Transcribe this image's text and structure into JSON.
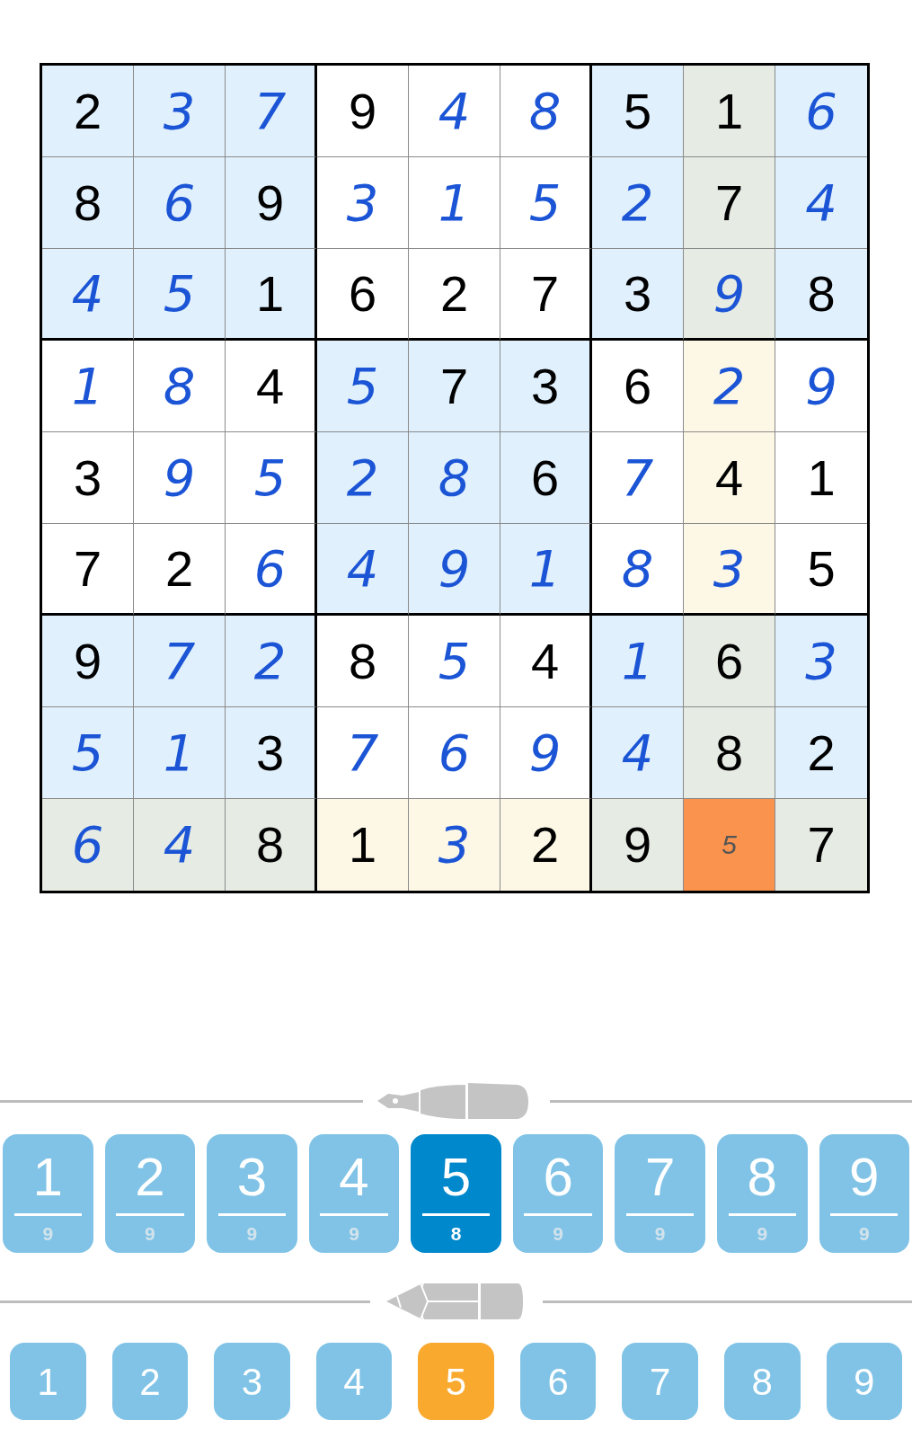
{
  "grid": [
    [
      {
        "v": "2",
        "kind": "given",
        "color": "#e0f0fc"
      },
      {
        "v": "3",
        "kind": "entered",
        "color": "#e0f0fc"
      },
      {
        "v": "7",
        "kind": "entered",
        "color": "#e0f0fc"
      },
      {
        "v": "9",
        "kind": "given",
        "color": "#ffffff"
      },
      {
        "v": "4",
        "kind": "entered",
        "color": "#ffffff"
      },
      {
        "v": "8",
        "kind": "entered",
        "color": "#ffffff"
      },
      {
        "v": "5",
        "kind": "given",
        "color": "#e0f0fc"
      },
      {
        "v": "1",
        "kind": "given",
        "color": "#e6ebe4"
      },
      {
        "v": "6",
        "kind": "entered",
        "color": "#e0f0fc"
      }
    ],
    [
      {
        "v": "8",
        "kind": "given",
        "color": "#e0f0fc"
      },
      {
        "v": "6",
        "kind": "entered",
        "color": "#e0f0fc"
      },
      {
        "v": "9",
        "kind": "given",
        "color": "#e0f0fc"
      },
      {
        "v": "3",
        "kind": "entered",
        "color": "#ffffff"
      },
      {
        "v": "1",
        "kind": "entered",
        "color": "#ffffff"
      },
      {
        "v": "5",
        "kind": "entered",
        "color": "#ffffff"
      },
      {
        "v": "2",
        "kind": "entered",
        "color": "#e0f0fc"
      },
      {
        "v": "7",
        "kind": "given",
        "color": "#e6ebe4"
      },
      {
        "v": "4",
        "kind": "entered",
        "color": "#e0f0fc"
      }
    ],
    [
      {
        "v": "4",
        "kind": "entered",
        "color": "#e0f0fc"
      },
      {
        "v": "5",
        "kind": "entered",
        "color": "#e0f0fc"
      },
      {
        "v": "1",
        "kind": "given",
        "color": "#e0f0fc"
      },
      {
        "v": "6",
        "kind": "given",
        "color": "#ffffff"
      },
      {
        "v": "2",
        "kind": "given",
        "color": "#ffffff"
      },
      {
        "v": "7",
        "kind": "given",
        "color": "#ffffff"
      },
      {
        "v": "3",
        "kind": "given",
        "color": "#e0f0fc"
      },
      {
        "v": "9",
        "kind": "entered",
        "color": "#e6ebe4"
      },
      {
        "v": "8",
        "kind": "given",
        "color": "#e0f0fc"
      }
    ],
    [
      {
        "v": "1",
        "kind": "entered",
        "color": "#ffffff"
      },
      {
        "v": "8",
        "kind": "entered",
        "color": "#ffffff"
      },
      {
        "v": "4",
        "kind": "given",
        "color": "#ffffff"
      },
      {
        "v": "5",
        "kind": "entered",
        "color": "#e0f0fc"
      },
      {
        "v": "7",
        "kind": "given",
        "color": "#e0f0fc"
      },
      {
        "v": "3",
        "kind": "given",
        "color": "#e0f0fc"
      },
      {
        "v": "6",
        "kind": "given",
        "color": "#ffffff"
      },
      {
        "v": "2",
        "kind": "entered",
        "color": "#fdf8e6"
      },
      {
        "v": "9",
        "kind": "entered",
        "color": "#ffffff"
      }
    ],
    [
      {
        "v": "3",
        "kind": "given",
        "color": "#ffffff"
      },
      {
        "v": "9",
        "kind": "entered",
        "color": "#ffffff"
      },
      {
        "v": "5",
        "kind": "entered",
        "color": "#ffffff"
      },
      {
        "v": "2",
        "kind": "entered",
        "color": "#e0f0fc"
      },
      {
        "v": "8",
        "kind": "entered",
        "color": "#e0f0fc"
      },
      {
        "v": "6",
        "kind": "given",
        "color": "#e0f0fc"
      },
      {
        "v": "7",
        "kind": "entered",
        "color": "#ffffff"
      },
      {
        "v": "4",
        "kind": "given",
        "color": "#fdf8e6"
      },
      {
        "v": "1",
        "kind": "given",
        "color": "#ffffff"
      }
    ],
    [
      {
        "v": "7",
        "kind": "given",
        "color": "#ffffff"
      },
      {
        "v": "2",
        "kind": "given",
        "color": "#ffffff"
      },
      {
        "v": "6",
        "kind": "entered",
        "color": "#ffffff"
      },
      {
        "v": "4",
        "kind": "entered",
        "color": "#e0f0fc"
      },
      {
        "v": "9",
        "kind": "entered",
        "color": "#e0f0fc"
      },
      {
        "v": "1",
        "kind": "entered",
        "color": "#e0f0fc"
      },
      {
        "v": "8",
        "kind": "entered",
        "color": "#ffffff"
      },
      {
        "v": "3",
        "kind": "entered",
        "color": "#fdf8e6"
      },
      {
        "v": "5",
        "kind": "given",
        "color": "#ffffff"
      }
    ],
    [
      {
        "v": "9",
        "kind": "given",
        "color": "#e0f0fc"
      },
      {
        "v": "7",
        "kind": "entered",
        "color": "#e0f0fc"
      },
      {
        "v": "2",
        "kind": "entered",
        "color": "#e0f0fc"
      },
      {
        "v": "8",
        "kind": "given",
        "color": "#ffffff"
      },
      {
        "v": "5",
        "kind": "entered",
        "color": "#ffffff"
      },
      {
        "v": "4",
        "kind": "given",
        "color": "#ffffff"
      },
      {
        "v": "1",
        "kind": "entered",
        "color": "#e0f0fc"
      },
      {
        "v": "6",
        "kind": "given",
        "color": "#e6ebe4"
      },
      {
        "v": "3",
        "kind": "entered",
        "color": "#e0f0fc"
      }
    ],
    [
      {
        "v": "5",
        "kind": "entered",
        "color": "#e0f0fc"
      },
      {
        "v": "1",
        "kind": "entered",
        "color": "#e0f0fc"
      },
      {
        "v": "3",
        "kind": "given",
        "color": "#e0f0fc"
      },
      {
        "v": "7",
        "kind": "entered",
        "color": "#ffffff"
      },
      {
        "v": "6",
        "kind": "entered",
        "color": "#ffffff"
      },
      {
        "v": "9",
        "kind": "entered",
        "color": "#ffffff"
      },
      {
        "v": "4",
        "kind": "entered",
        "color": "#e0f0fc"
      },
      {
        "v": "8",
        "kind": "given",
        "color": "#e6ebe4"
      },
      {
        "v": "2",
        "kind": "given",
        "color": "#e0f0fc"
      }
    ],
    [
      {
        "v": "6",
        "kind": "entered",
        "color": "#e6ebe4"
      },
      {
        "v": "4",
        "kind": "entered",
        "color": "#e6ebe4"
      },
      {
        "v": "8",
        "kind": "given",
        "color": "#e6ebe4"
      },
      {
        "v": "1",
        "kind": "given",
        "color": "#fdf8e6"
      },
      {
        "v": "3",
        "kind": "entered",
        "color": "#fdf8e6"
      },
      {
        "v": "2",
        "kind": "given",
        "color": "#fdf8e6"
      },
      {
        "v": "9",
        "kind": "given",
        "color": "#e6ebe4"
      },
      {
        "v": "5",
        "kind": "note",
        "color": "#f9934d"
      },
      {
        "v": "7",
        "kind": "given",
        "color": "#e6ebe4"
      }
    ]
  ],
  "pen_keys": [
    {
      "digit": "1",
      "count": "9",
      "selected": false
    },
    {
      "digit": "2",
      "count": "9",
      "selected": false
    },
    {
      "digit": "3",
      "count": "9",
      "selected": false
    },
    {
      "digit": "4",
      "count": "9",
      "selected": false
    },
    {
      "digit": "5",
      "count": "8",
      "selected": true
    },
    {
      "digit": "6",
      "count": "9",
      "selected": false
    },
    {
      "digit": "7",
      "count": "9",
      "selected": false
    },
    {
      "digit": "8",
      "count": "9",
      "selected": false
    },
    {
      "digit": "9",
      "count": "9",
      "selected": false
    }
  ],
  "pencil_keys": [
    {
      "digit": "1",
      "selected": false
    },
    {
      "digit": "2",
      "selected": false
    },
    {
      "digit": "3",
      "selected": false
    },
    {
      "digit": "4",
      "selected": false
    },
    {
      "digit": "5",
      "selected": true
    },
    {
      "digit": "6",
      "selected": false
    },
    {
      "digit": "7",
      "selected": false
    },
    {
      "digit": "8",
      "selected": false
    },
    {
      "digit": "9",
      "selected": false
    }
  ]
}
